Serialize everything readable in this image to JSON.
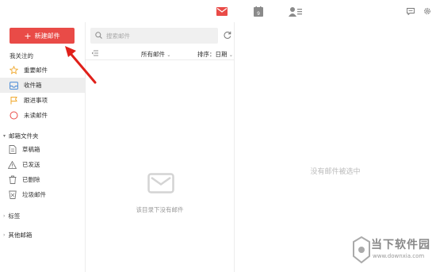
{
  "topbar": {
    "icons": [
      "mail-icon",
      "calendar-icon",
      "contacts-icon",
      "message-icon",
      "gear-icon"
    ],
    "calendar_day": "9",
    "accent": "#e94b47"
  },
  "sidebar": {
    "compose_label": "新建邮件",
    "favorites_label": "我关注的",
    "favorites": [
      {
        "label": "重要邮件",
        "icon": "star-icon"
      },
      {
        "label": "收件箱",
        "icon": "inbox-icon"
      },
      {
        "label": "跟进事项",
        "icon": "flag-icon"
      },
      {
        "label": "未读邮件",
        "icon": "circle-icon"
      }
    ],
    "folders_label": "邮箱文件夹",
    "folders": [
      {
        "label": "草稿箱",
        "icon": "draft-icon"
      },
      {
        "label": "已发送",
        "icon": "sent-icon"
      },
      {
        "label": "已删除",
        "icon": "trash-icon"
      },
      {
        "label": "垃圾邮件",
        "icon": "spam-icon"
      }
    ],
    "tags_label": "标签",
    "other_label": "其他邮箱"
  },
  "list": {
    "search_placeholder": "搜索邮件",
    "filter_label": "所有邮件",
    "sort_label": "排序：日期",
    "empty_text": "该目录下没有邮件"
  },
  "preview": {
    "empty_text": "没有邮件被选中"
  },
  "watermark": {
    "title": "当下软件园",
    "url": "www.downxia.com"
  }
}
